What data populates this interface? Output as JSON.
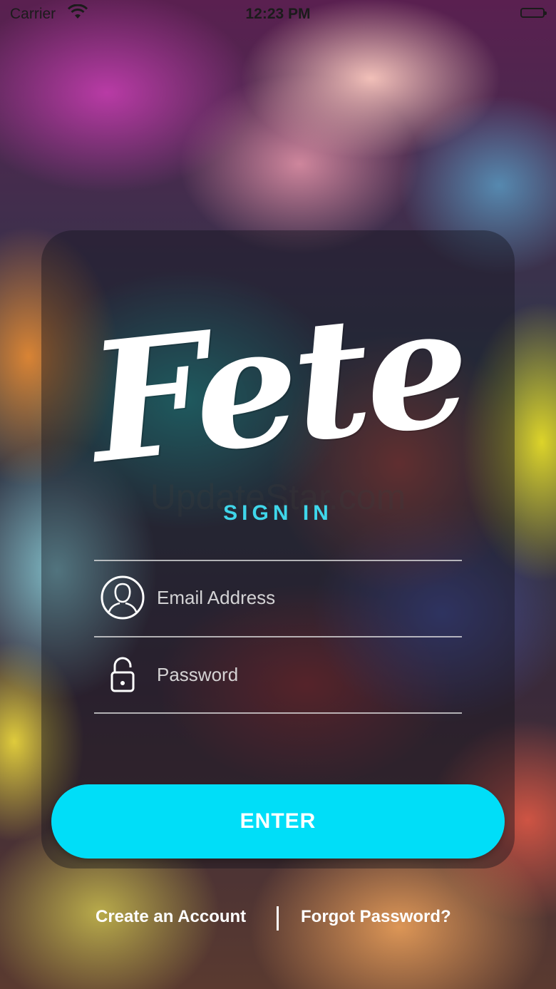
{
  "status_bar": {
    "carrier": "Carrier",
    "time": "12:23 PM",
    "icons": [
      "wifi-icon",
      "battery-icon"
    ]
  },
  "brand": {
    "logo_text": "Fete",
    "watermark": "UpdateStar.com"
  },
  "form": {
    "heading": "SIGN IN",
    "email": {
      "placeholder": "Email Address",
      "value": "",
      "icon": "user-circle-icon"
    },
    "password": {
      "placeholder": "Password",
      "value": "",
      "icon": "lock-icon"
    },
    "submit_label": "ENTER"
  },
  "footer": {
    "create_account_label": "Create an Account",
    "forgot_password_label": "Forgot Password?"
  },
  "colors": {
    "accent": "#00def8",
    "heading": "#3fd6ea",
    "text": "#ffffff"
  }
}
